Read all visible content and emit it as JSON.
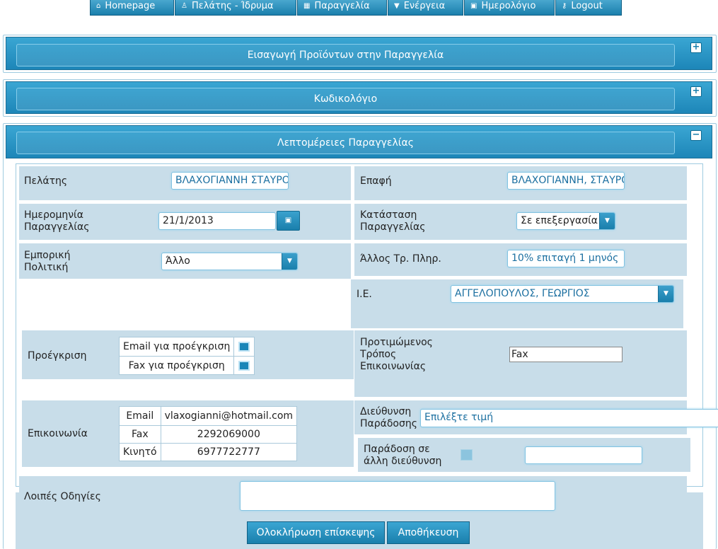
{
  "nav": {
    "items": [
      {
        "label": "Homepage",
        "icon": "home-icon",
        "glyph": "⌂"
      },
      {
        "label": "Πελάτης - Ίδρυμα",
        "icon": "user-icon",
        "glyph": "♙"
      },
      {
        "label": "Παραγγελία",
        "icon": "grid-icon",
        "glyph": "▦"
      },
      {
        "label": "Ενέργεια",
        "icon": "caret-down-icon",
        "glyph": "▼"
      },
      {
        "label": "Ημερολόγιο",
        "icon": "calendar-icon",
        "glyph": "▣"
      },
      {
        "label": "Logout",
        "icon": "key-icon",
        "glyph": "⚷"
      }
    ]
  },
  "panels": {
    "products": {
      "title": "Εισαγωγή Προϊόντων στην Παραγγελία",
      "toggle": "+"
    },
    "codebook": {
      "title": "Κωδικολόγιο",
      "toggle": "+"
    },
    "details": {
      "title": "Λεπτομέρειες Παραγγελίας",
      "toggle": "−"
    }
  },
  "form": {
    "customer": {
      "label": "Πελάτης",
      "value": "ΒΛΑΧΟΓΙΑΝΝΗ ΣΤΑΥΡΟΥΛΑ"
    },
    "contact": {
      "label": "Επαφή",
      "value": "ΒΛΑΧΟΓΙΑΝΝΗ, ΣΤΑΥΡΟΥΛΑ"
    },
    "order_date": {
      "label_1": "Ημερομηνία",
      "label_2": "Παραγγελίας",
      "value": "21/1/2013"
    },
    "order_status": {
      "label_1": "Κατάσταση",
      "label_2": "Παραγγελίας",
      "value": "Σε επεξεργασία"
    },
    "commercial_policy": {
      "label_1": "Εμπορική",
      "label_2": "Πολιτική",
      "value": "Άλλο"
    },
    "other_payment": {
      "label": "Άλλος Τρ. Πληρ.",
      "value": "10% επιταγή 1 μηνός"
    },
    "ie": {
      "label": "Ι.Ε.",
      "value": "ΑΓΓΕΛΟΠΟΥΛΟΣ, ΓΕΩΡΓΙΟΣ"
    },
    "preapproval": {
      "label": "Προέγκριση",
      "rows": [
        {
          "label": "Email για προέγκριση",
          "checked": true
        },
        {
          "label": "Fax για προέγκριση",
          "checked": true
        }
      ]
    },
    "preferred_contact": {
      "label_1": "Προτιμώμενος",
      "label_2": "Τρόπος",
      "label_3": "Επικοινωνίας",
      "value": "Fax"
    },
    "communication": {
      "label": "Επικοινωνία",
      "rows": [
        {
          "key": "Email",
          "value": "vlaxogianni@hotmail.com"
        },
        {
          "key": "Fax",
          "value": "2292069000"
        },
        {
          "key": "Κινητό",
          "value": "6977722777"
        }
      ]
    },
    "delivery_address": {
      "label_1": "Διεύθυνση",
      "label_2": "Παράδοσης",
      "placeholder": "Επιλέξτε τιμή"
    },
    "other_address": {
      "label_1": "Παράδοση σε",
      "label_2": "άλλη διεύθυνση",
      "value": ""
    },
    "other_instructions": {
      "label": "Λοιπές Οδηγίες",
      "value": ""
    }
  },
  "actions": {
    "complete_visit": "Ολοκλήρωση επίσκεψης",
    "save": "Αποθήκευση"
  }
}
